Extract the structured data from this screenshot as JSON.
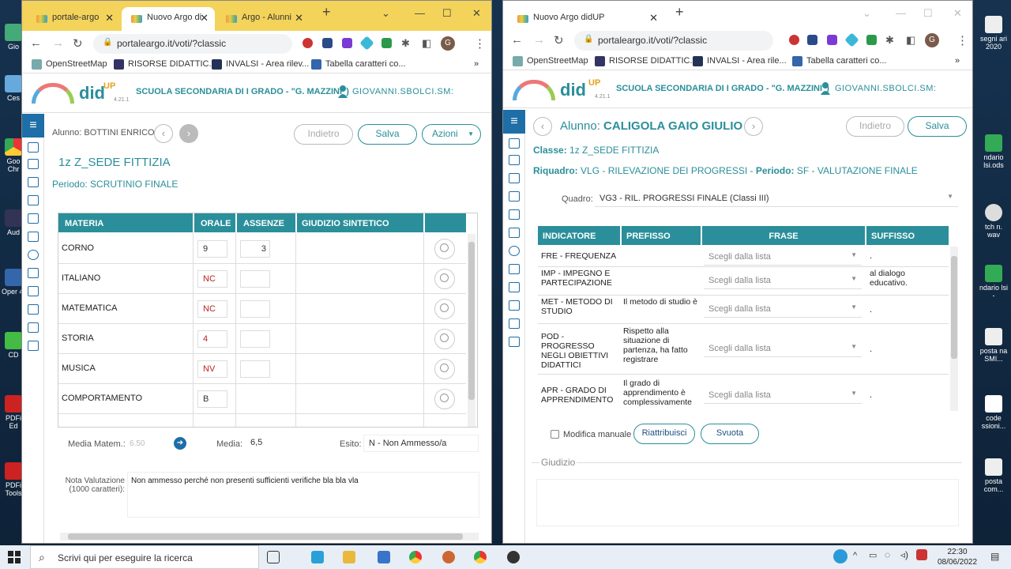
{
  "desktop": {
    "icons": [
      {
        "label": "Gio"
      },
      {
        "label": "Ces"
      },
      {
        "label": "Goo Chr"
      },
      {
        "label": "Aud"
      },
      {
        "label": "Oper 4."
      },
      {
        "label": "CD"
      },
      {
        "label": "PDFi Ed"
      },
      {
        "label": "PDFi Tools"
      }
    ],
    "right_icons": [
      {
        "label": "segni ari 2020"
      },
      {
        "label": "ndario lsi.ods"
      },
      {
        "label": "tch n. wav"
      },
      {
        "label": "ndario lsi -"
      },
      {
        "label": "posta na SMI..."
      },
      {
        "label": "code ssioni..."
      },
      {
        "label": "posta com..."
      }
    ]
  },
  "left": {
    "tabs": [
      {
        "label": "portale-argo"
      },
      {
        "label": "Nuovo Argo di"
      },
      {
        "label": "Argo - Alunni"
      }
    ],
    "url": "portaleargo.it/voti/?classic",
    "bookmarks": [
      "OpenStreetMap",
      "RISORSE DIDATTIC...",
      "INVALSI - Area rilev...",
      "Tabella caratteri co..."
    ],
    "logo": "did",
    "logo_sup": "UP",
    "version": "4.21.1",
    "school": "SCUOLA SECONDARIA DI I GRADO - \"G. MAZZINI\")",
    "user": "GIOVANNI.SBOLCI.SM:",
    "student": "Alunno: BOTTINI ENRICO",
    "btn_back": "Indietro",
    "btn_save": "Salva",
    "btn_actions": "Azioni",
    "class_title": "1z Z_SEDE FITTIZIA",
    "period": "Periodo: SCRUTINIO FINALE",
    "headers": {
      "materia": "MATERIA",
      "orale": "ORALE",
      "assenze": "ASSENZE",
      "giudizio": "GIUDIZIO SINTETICO"
    },
    "rows": [
      {
        "materia": "CORNO",
        "orale": "9",
        "assenze": "3"
      },
      {
        "materia": "ITALIANO",
        "orale": "NC",
        "assenze": ""
      },
      {
        "materia": "MATEMATICA",
        "orale": "NC",
        "assenze": ""
      },
      {
        "materia": "STORIA",
        "orale": "4",
        "assenze": ""
      },
      {
        "materia": "MUSICA",
        "orale": "NV",
        "assenze": ""
      },
      {
        "materia": "COMPORTAMENTO",
        "orale": "B",
        "assenze": ""
      }
    ],
    "media_mat_label": "Media Matem.:",
    "media_mat_val": "6.50",
    "media_label": "Media:",
    "media_val": "6,5",
    "esito_label": "Esito:",
    "esito_val": "N - Non Ammesso/a",
    "nota_label": "Nota Valutazione (1000 caratteri):",
    "nota_val": "Non ammesso perché non presenti sufficienti verifiche bla bla vla"
  },
  "right": {
    "tabs": [
      {
        "label": "Nuovo Argo didUP"
      }
    ],
    "url": "portaleargo.it/voti/?classic",
    "bookmarks": [
      "OpenStreetMap",
      "RISORSE DIDATTIC...",
      "INVALSI - Area rile...",
      "Tabella caratteri co..."
    ],
    "logo": "did",
    "logo_sup": "UP",
    "version": "4.21.1",
    "school": "SCUOLA SECONDARIA DI I GRADO - \"G. MAZZINI\")",
    "user": "GIOVANNI.SBOLCI.SM:",
    "student_label": "Alunno:",
    "student_name": "CALIGOLA GAIO GIULIO",
    "btn_back": "Indietro",
    "btn_save": "Salva",
    "classe_label": "Classe:",
    "classe_val": "1z Z_SEDE FITTIZIA",
    "riquadro_label": "Riquadro:",
    "riquadro_val": "VLG - RILEVAZIONE DEI PROGRESSI -",
    "periodo_label": "Periodo:",
    "periodo_val": "SF - VALUTAZIONE FINALE",
    "quadro_label": "Quadro:",
    "quadro_val": "VG3 - RIL. PROGRESSI FINALE (Classi III)",
    "headers": {
      "indicatore": "INDICATORE",
      "prefisso": "PREFISSO",
      "frase": "FRASE",
      "suffisso": "SUFFISSO"
    },
    "select_placeholder": "Scegli dalla lista",
    "rows": [
      {
        "indicatore": "FRE - FREQUENZA",
        "prefisso": "",
        "suffisso": "."
      },
      {
        "indicatore": "IMP - IMPEGNO E PARTECIPAZIONE",
        "prefisso": "",
        "suffisso": "al dialogo educativo."
      },
      {
        "indicatore": "MET - METODO DI STUDIO",
        "prefisso": "Il metodo di studio è",
        "suffisso": "."
      },
      {
        "indicatore": "POD - PROGRESSO NEGLI OBIETTIVI DIDATTICI",
        "prefisso": "Rispetto alla situazione di partenza, ha fatto registrare",
        "suffisso": "."
      },
      {
        "indicatore": "APR - GRADO DI APPRENDIMENTO",
        "prefisso": "Il grado di apprendimento è complessivamente",
        "suffisso": "."
      }
    ],
    "modifica_label": "Modifica manuale",
    "btn_riattribuisci": "Riattribuisci",
    "btn_svuota": "Svuota",
    "giudizio_label": "Giudizio"
  },
  "taskbar": {
    "search_placeholder": "Scrivi qui per eseguire la ricerca",
    "time": "22:30",
    "date": "08/06/2022"
  }
}
